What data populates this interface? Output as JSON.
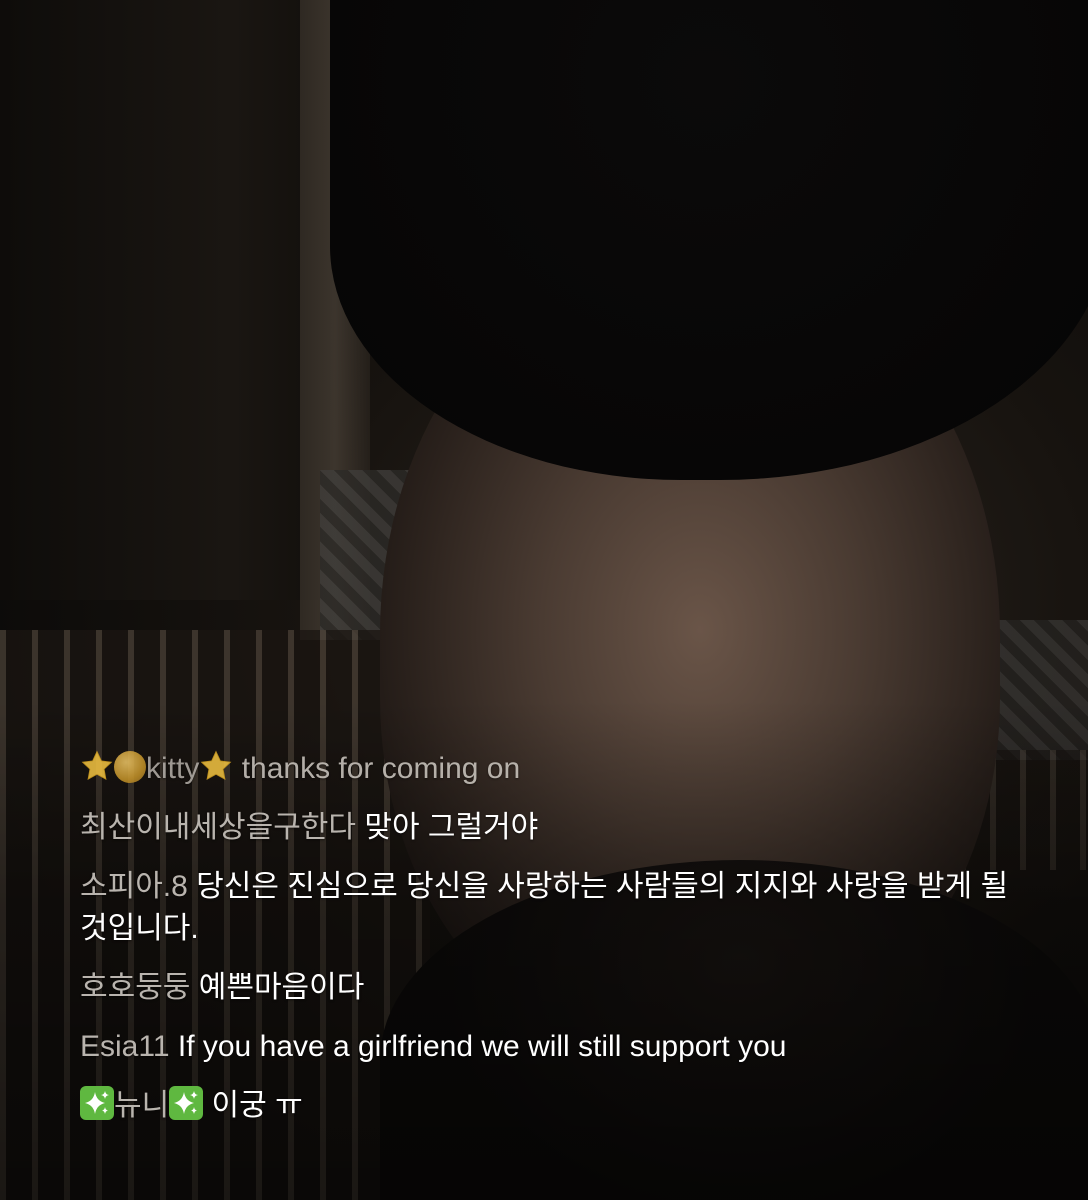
{
  "comments": [
    {
      "user": "kitty",
      "text": "thanks for coming on",
      "user_emoji_before": [
        "star",
        "moon"
      ],
      "user_emoji_after": [
        "star"
      ]
    },
    {
      "user": "최산이내세상을구한다",
      "text": "맞아 그럴거야"
    },
    {
      "user": "소피아.8",
      "text": "당신은 진심으로 당신을 사랑하는 사람들의 지지와 사랑을 받게 될 것입니다."
    },
    {
      "user": "호호둥둥",
      "text": "예쁜마음이다"
    },
    {
      "user": "Esia11",
      "text": "If you have a girlfriend we will still support you"
    },
    {
      "user": "뉴니",
      "text": "이궁 ㅠ",
      "user_emoji_before": [
        "sparkles"
      ],
      "user_emoji_after": [
        "sparkles"
      ]
    }
  ],
  "colors": {
    "username": "#b9b4ae",
    "message": "#ffffff",
    "sparkle_bg": "#5fb840",
    "star": "#f5c542"
  }
}
